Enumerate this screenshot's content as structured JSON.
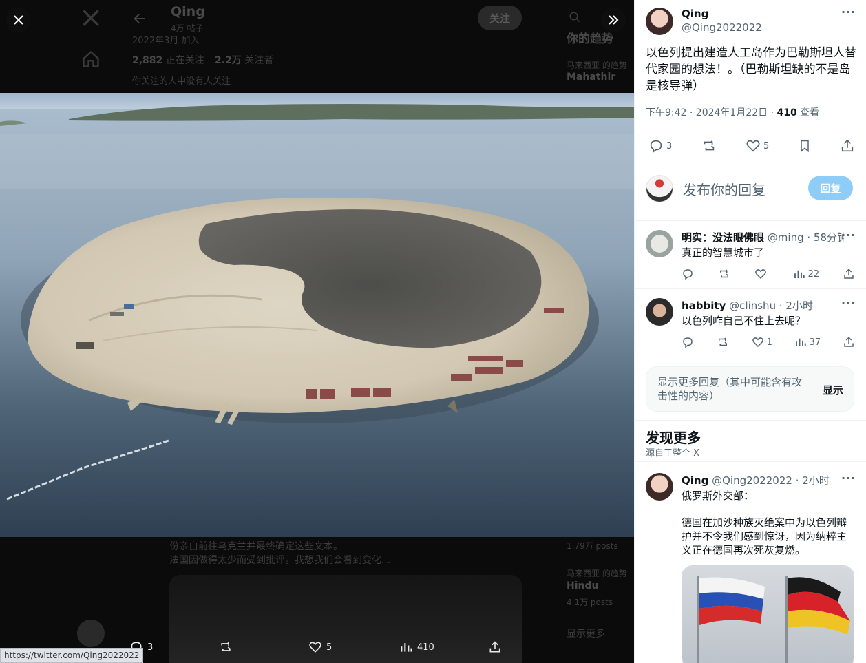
{
  "background": {
    "profile_name": "Qing",
    "post_count": "4万 帖子",
    "joined": "2022年3月 加入",
    "following_count": "2,882",
    "following_label": "正在关注",
    "followers_count": "2.2万",
    "followers_label": "关注者",
    "mutual_note": "你关注的人中没有人关注",
    "follow_button": "关注",
    "trends_title": "你的趋势",
    "trend1_ctx": "马来西亚 的趋势",
    "trend1_name": "Mahathir",
    "trend1_count": "",
    "trend2_count": "1.79万 posts",
    "trend3_ctx": "马来西亚 的趋势",
    "trend3_name": "Hindu",
    "trend3_count": "4.1万 posts",
    "show_more": "显示更多",
    "bg_tweet_line1": "份亲自前往乌克兰并最终确定这些文本。",
    "bg_tweet_line2": "法国因做得太少而受到批评。我想我们会看到变化..."
  },
  "media_actions": {
    "replies": "3",
    "likes": "5",
    "views": "410"
  },
  "status_url": "https://twitter.com/Qing2022022",
  "main_tweet": {
    "name": "Qing",
    "handle": "@Qing2022022",
    "text": "以色列提出建造人工岛作为巴勒斯坦人替代家园的想法！。（巴勒斯坦缺的不是岛是核导弹）",
    "time": "下午9:42 · 2024年1月22日 · ",
    "views_count": "410",
    "views_label": " 查看",
    "replies": "3",
    "likes": "5"
  },
  "reply_box": {
    "placeholder": "发布你的回复",
    "button": "回复"
  },
  "replies": [
    {
      "name": "明实：没法眼佛眼",
      "handle": "@ming",
      "time": "· 58分钟",
      "text": "真正的智慧城市了",
      "likes": "",
      "views": "22"
    },
    {
      "name": "habbity",
      "handle": "@clinshu",
      "time": "· 2小时",
      "text": "以色列咋自己不住上去呢？",
      "likes": "1",
      "views": "37"
    }
  ],
  "more_replies": {
    "text": "显示更多回复（其中可能含有攻击性的内容）",
    "button": "显示"
  },
  "discover": {
    "title": "发现更多",
    "subtitle": "源自于整个 X"
  },
  "discover_tweet": {
    "name": "Qing",
    "handle": "@Qing2022022",
    "time": "· 2小时",
    "line1": "俄罗斯外交部：",
    "line2": "德国在加沙种族灭绝案中为以色列辩护并不令我们感到惊讶，因为纳粹主义正在德国再次死灰复燃。"
  },
  "colors": {
    "accent": "#1d9bf0",
    "reply_button_disabled": "#8ecdf8",
    "text_primary": "#0f1419",
    "text_muted": "#536471"
  }
}
